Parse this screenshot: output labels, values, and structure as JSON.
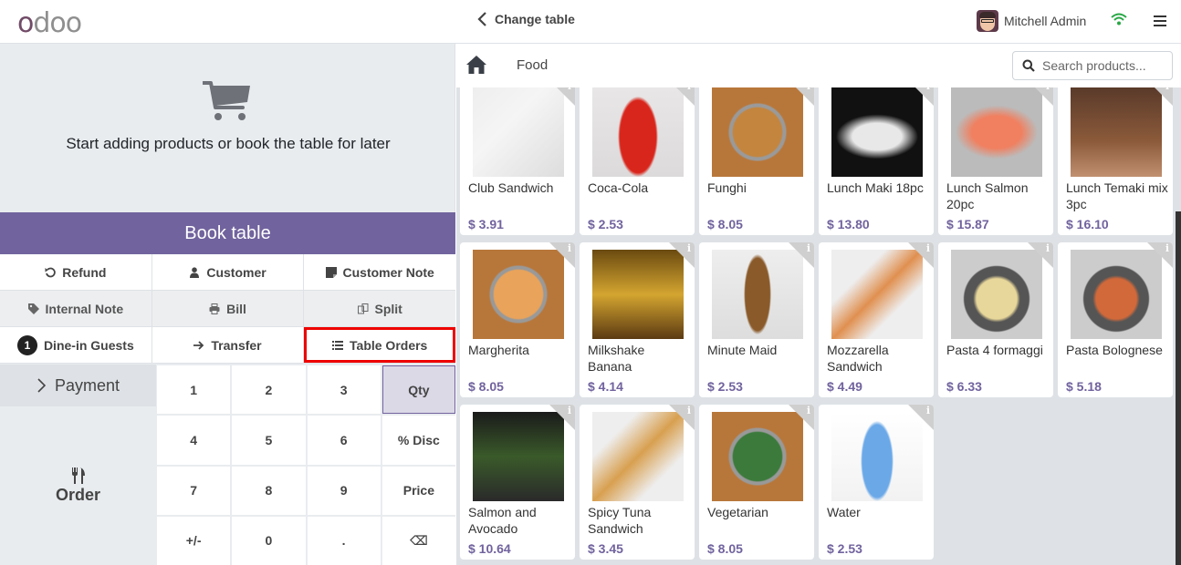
{
  "header": {
    "logo": "odoo",
    "change_table": "Change table",
    "user_name": "Mitchell Admin"
  },
  "order_panel": {
    "empty_message": "Start adding products or book the table for later",
    "book_table": "Book table",
    "controls": [
      [
        {
          "label": "Refund",
          "icon": "refund-icon"
        },
        {
          "label": "Customer",
          "icon": "user-icon"
        },
        {
          "label": "Customer Note",
          "icon": "note-icon"
        }
      ],
      [
        {
          "label": "Internal Note",
          "icon": "tag-icon"
        },
        {
          "label": "Bill",
          "icon": "print-icon"
        },
        {
          "label": "Split",
          "icon": "split-icon"
        }
      ],
      [
        {
          "label": "Dine-in Guests",
          "badge": "1"
        },
        {
          "label": "Transfer",
          "icon": "arrow-right-icon"
        },
        {
          "label": "Table Orders",
          "icon": "list-icon",
          "highlighted": true
        }
      ]
    ],
    "payment": "Payment",
    "order": "Order",
    "numpad": [
      "1",
      "2",
      "3",
      "Qty",
      "4",
      "5",
      "6",
      "% Disc",
      "7",
      "8",
      "9",
      "Price",
      "+/-",
      "0",
      ".",
      "⌫"
    ],
    "active_mode": "Qty"
  },
  "products_panel": {
    "category": "Food",
    "search_placeholder": "Search products...",
    "products": [
      {
        "name": "Club Sandwich",
        "price": "$ 3.91"
      },
      {
        "name": "Coca-Cola",
        "price": "$ 2.53"
      },
      {
        "name": "Funghi",
        "price": "$ 8.05"
      },
      {
        "name": "Lunch Maki 18pc",
        "price": "$ 13.80"
      },
      {
        "name": "Lunch Salmon 20pc",
        "price": "$ 15.87"
      },
      {
        "name": "Lunch Temaki mix 3pc",
        "price": "$ 16.10"
      },
      {
        "name": "Margherita",
        "price": "$ 8.05"
      },
      {
        "name": "Milkshake Banana",
        "price": "$ 4.14"
      },
      {
        "name": "Minute Maid",
        "price": "$ 2.53"
      },
      {
        "name": "Mozzarella Sandwich",
        "price": "$ 4.49"
      },
      {
        "name": "Pasta 4 formaggi",
        "price": "$ 6.33"
      },
      {
        "name": "Pasta Bolognese",
        "price": "$ 5.18"
      },
      {
        "name": "Salmon and Avocado",
        "price": "$ 10.64"
      },
      {
        "name": "Spicy Tuna Sandwich",
        "price": "$ 3.45"
      },
      {
        "name": "Vegetarian",
        "price": "$ 8.05"
      },
      {
        "name": "Water",
        "price": "$ 2.53"
      }
    ]
  },
  "colors": {
    "brand": "#714b67",
    "accent": "#71639e",
    "highlight_box": "#e00000",
    "wifi": "#28a745"
  }
}
